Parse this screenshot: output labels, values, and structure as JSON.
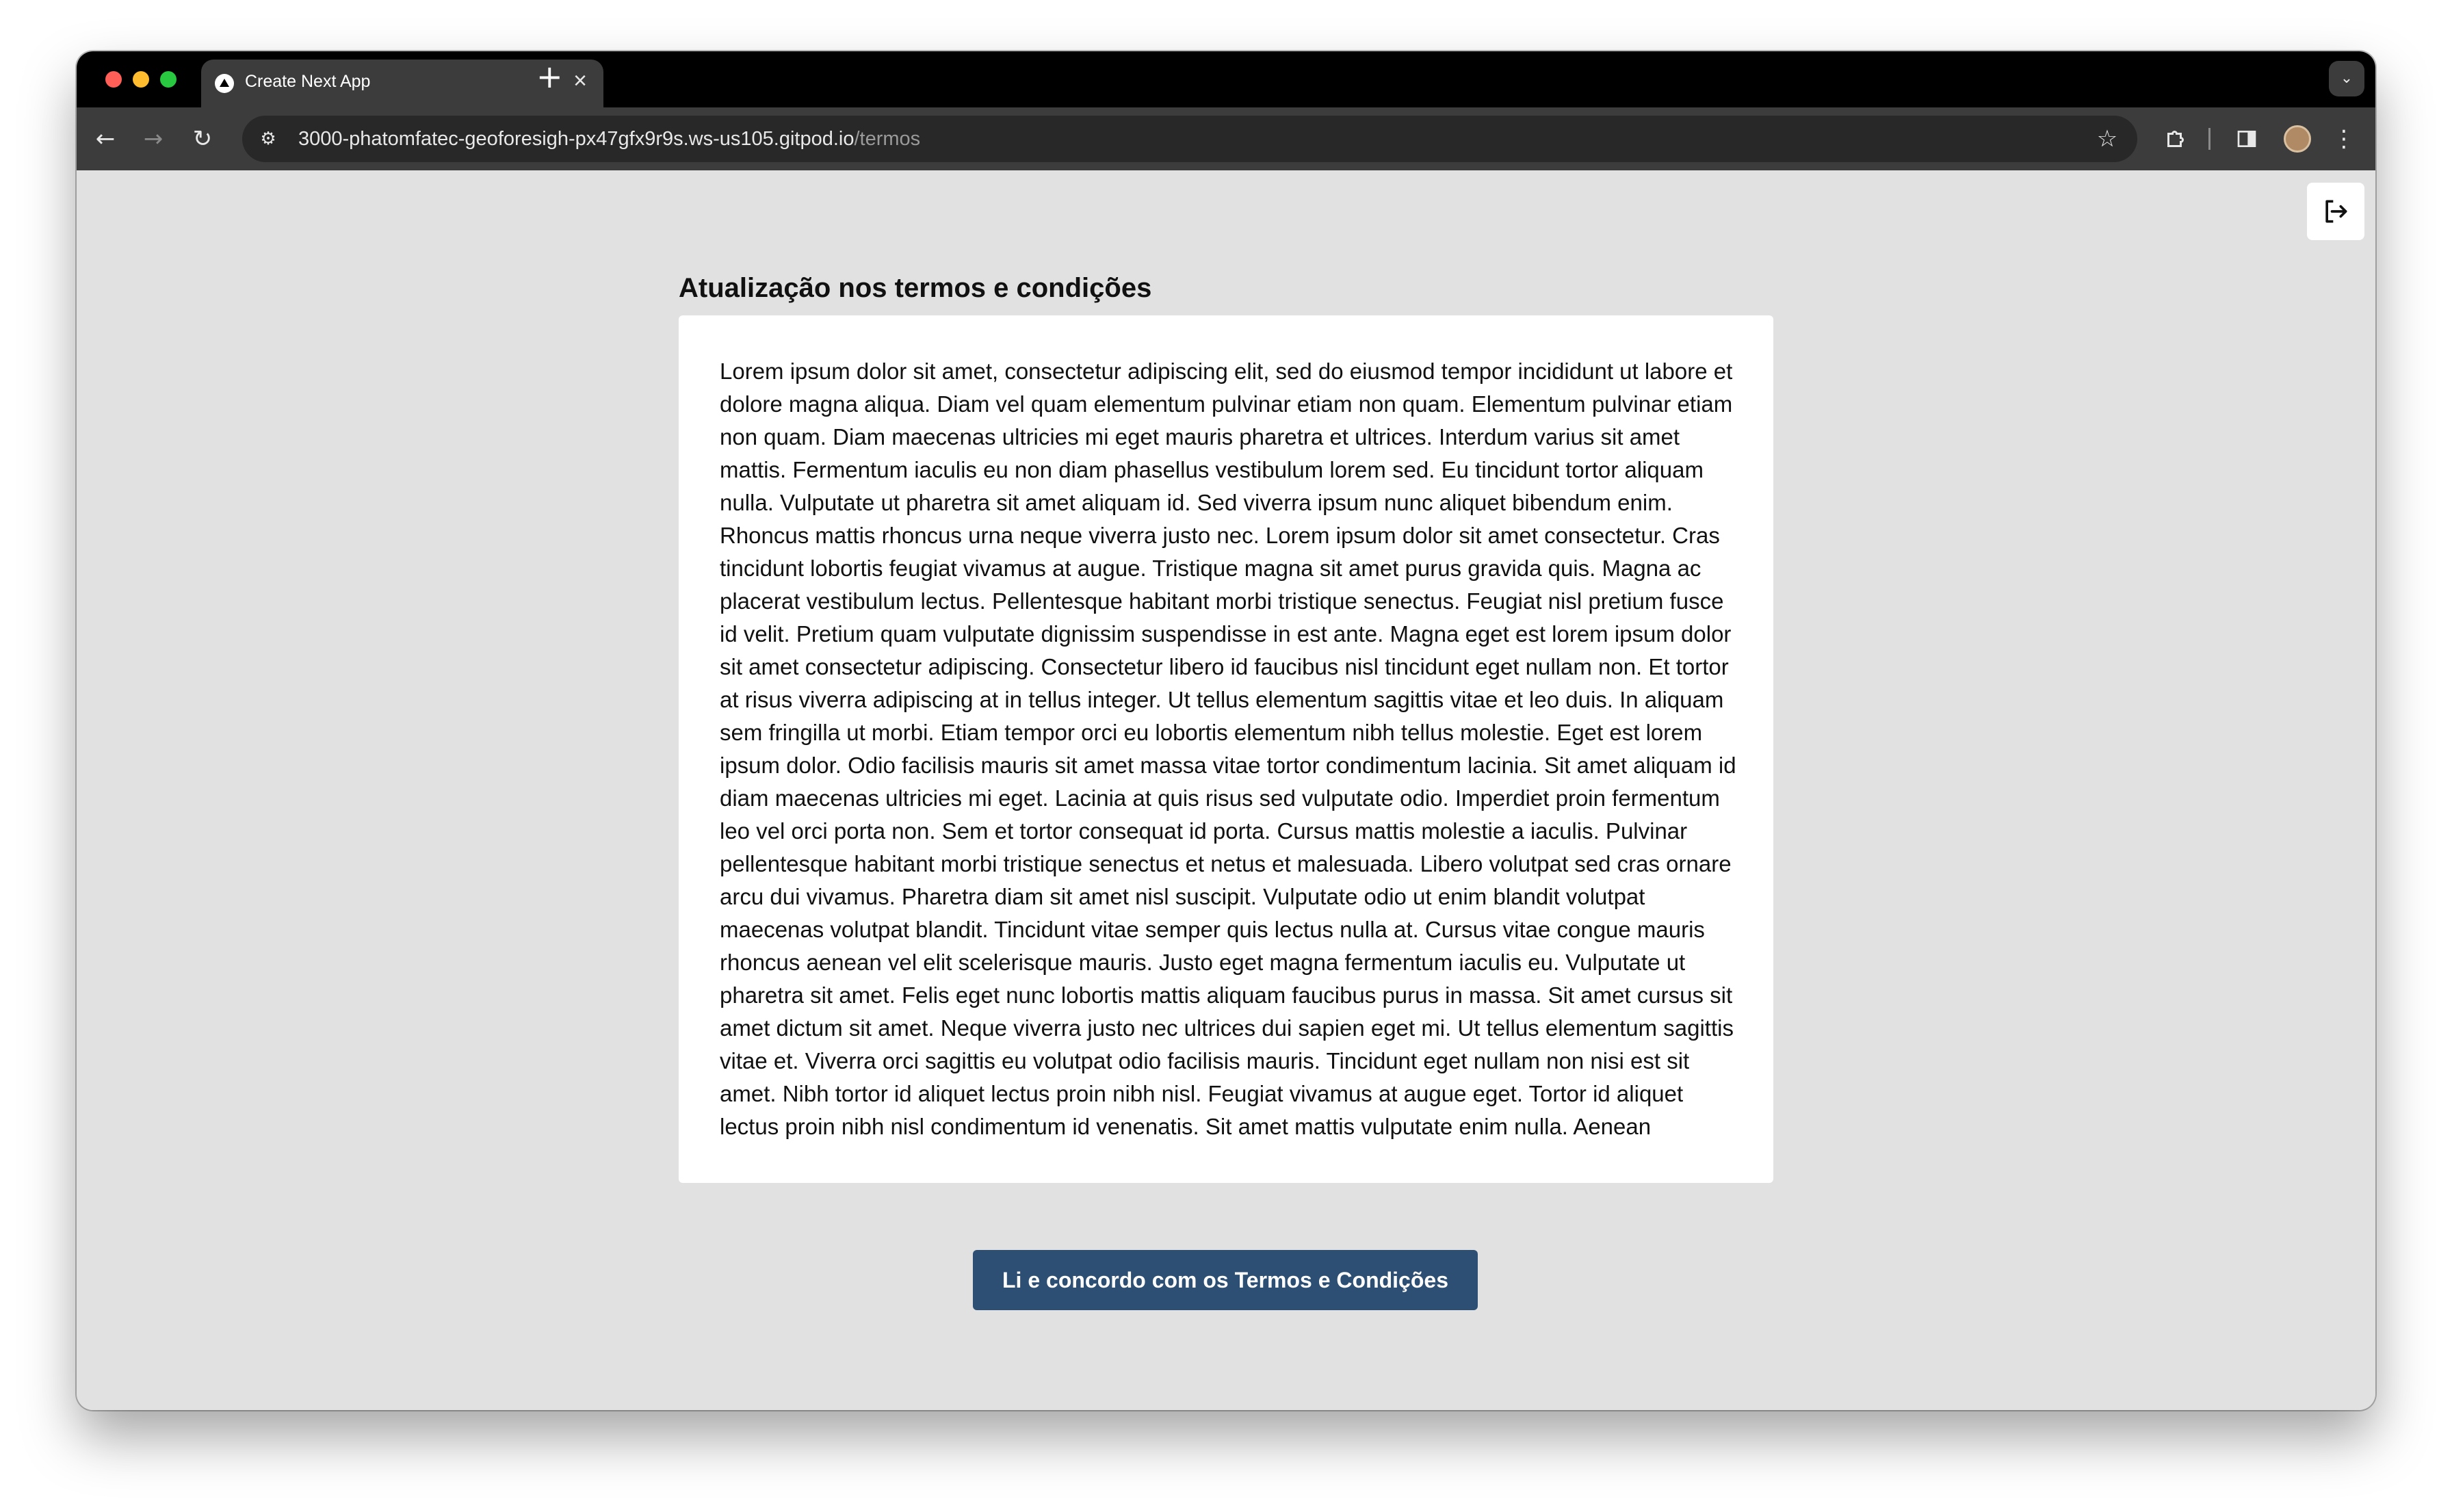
{
  "browser": {
    "tab_title": "Create Next App",
    "tab_close_glyph": "×",
    "new_tab_glyph": "+",
    "url_host": "3000-phatomfatec-geoforesigh-px47gfx9r9s.ws-us105.gitpod.io",
    "url_path": "/termos"
  },
  "page": {
    "title": "Atualização nos termos e condições",
    "terms_text": "Lorem ipsum dolor sit amet, consectetur adipiscing elit, sed do eiusmod tempor incididunt ut labore et dolore magna aliqua. Diam vel quam elementum pulvinar etiam non quam. Elementum pulvinar etiam non quam. Diam maecenas ultricies mi eget mauris pharetra et ultrices. Interdum varius sit amet mattis. Fermentum iaculis eu non diam phasellus vestibulum lorem sed. Eu tincidunt tortor aliquam nulla. Vulputate ut pharetra sit amet aliquam id. Sed viverra ipsum nunc aliquet bibendum enim. Rhoncus mattis rhoncus urna neque viverra justo nec. Lorem ipsum dolor sit amet consectetur. Cras tincidunt lobortis feugiat vivamus at augue. Tristique magna sit amet purus gravida quis. Magna ac placerat vestibulum lectus. Pellentesque habitant morbi tristique senectus. Feugiat nisl pretium fusce id velit. Pretium quam vulputate dignissim suspendisse in est ante. Magna eget est lorem ipsum dolor sit amet consectetur adipiscing. Consectetur libero id faucibus nisl tincidunt eget nullam non. Et tortor at risus viverra adipiscing at in tellus integer. Ut tellus elementum sagittis vitae et leo duis. In aliquam sem fringilla ut morbi. Etiam tempor orci eu lobortis elementum nibh tellus molestie. Eget est lorem ipsum dolor. Odio facilisis mauris sit amet massa vitae tortor condimentum lacinia. Sit amet aliquam id diam maecenas ultricies mi eget. Lacinia at quis risus sed vulputate odio. Imperdiet proin fermentum leo vel orci porta non. Sem et tortor consequat id porta. Cursus mattis molestie a iaculis. Pulvinar pellentesque habitant morbi tristique senectus et netus et malesuada. Libero volutpat sed cras ornare arcu dui vivamus. Pharetra diam sit amet nisl suscipit. Vulputate odio ut enim blandit volutpat maecenas volutpat blandit. Tincidunt vitae semper quis lectus nulla at. Cursus vitae congue mauris rhoncus aenean vel elit scelerisque mauris. Justo eget magna fermentum iaculis eu. Vulputate ut pharetra sit amet. Felis eget nunc lobortis mattis aliquam faucibus purus in massa. Sit amet cursus sit amet dictum sit amet. Neque viverra justo nec ultrices dui sapien eget mi. Ut tellus elementum sagittis vitae et. Viverra orci sagittis eu volutpat odio facilisis mauris. Tincidunt eget nullam non nisi est sit amet. Nibh tortor id aliquet lectus proin nibh nisl. Feugiat vivamus at augue eget. Tortor id aliquet lectus proin nibh nisl condimentum id venenatis. Sit amet mattis vulputate enim nulla. Aenean",
    "accept_button_label": "Li e concordo com os Termos e Condições"
  },
  "icons": {
    "back": "arrow-left-icon",
    "forward": "arrow-right-icon",
    "reload": "reload-icon",
    "site_info": "tune-icon",
    "bookmark": "star-icon",
    "extensions": "puzzle-icon",
    "side_panel": "side-panel-icon",
    "menu": "kebab-menu-icon",
    "logout": "logout-icon"
  },
  "colors": {
    "accent_button": "#2d4f74",
    "page_background": "#e1e1e1"
  }
}
